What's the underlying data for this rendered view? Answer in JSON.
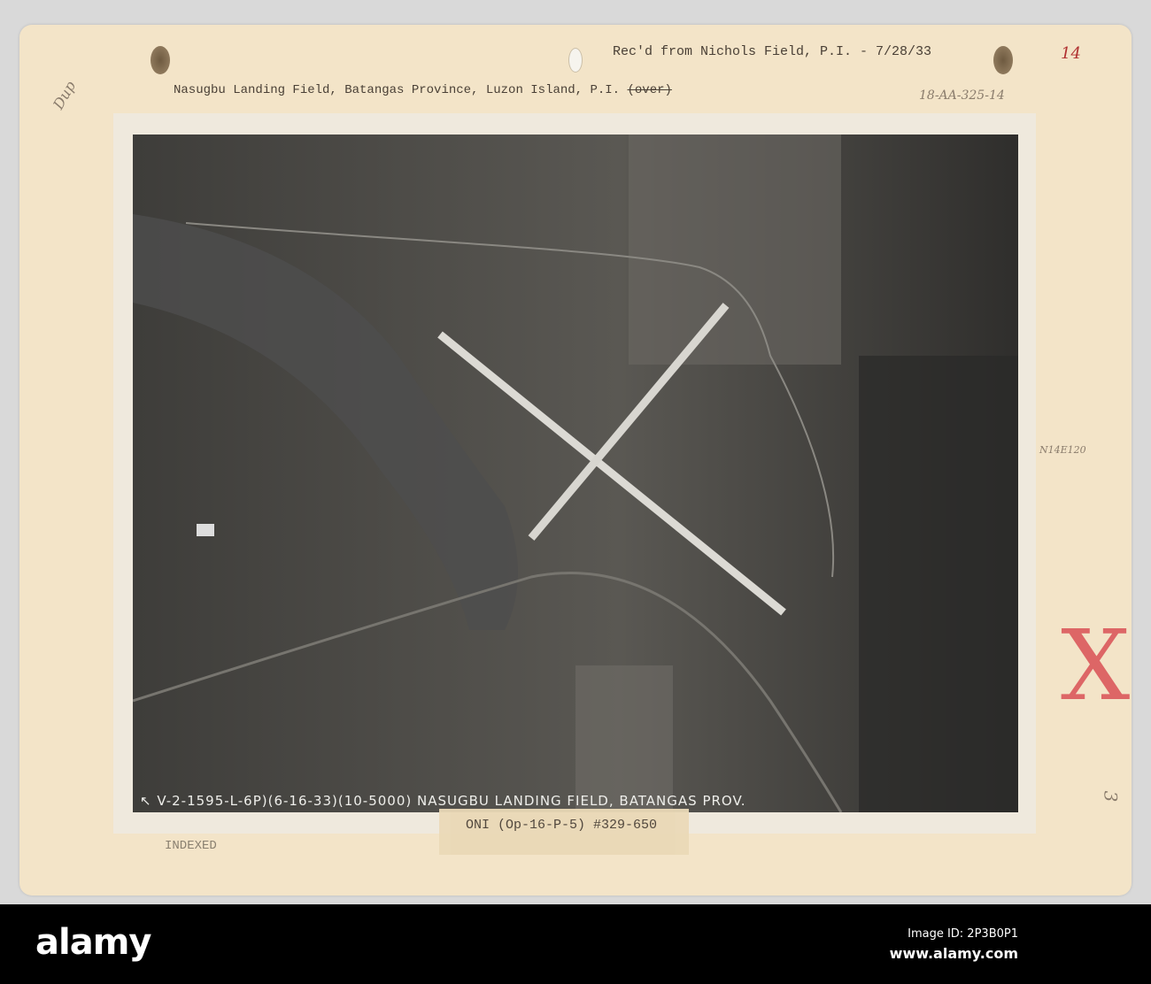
{
  "document": {
    "received_note": "Rec'd from Nichols Field, P.I. - 7/28/33",
    "title_line": "Nasugbu Landing Field, Batangas Province, Luzon Island, P.I.",
    "title_struck": "(over)",
    "handwritten_top_left": "Dup",
    "handwritten_top_right": "14",
    "file_number": "18-AA-325-14",
    "coordinates_note": "N14E120",
    "margin_mark": "X",
    "margin_number": "3",
    "photo_caption": "↖ V-2-1595-L-6P)(6-16-33)(10-5000) NASUGBU  LANDING  FIELD,  BATANGAS  PROV.",
    "tape_label": "ONI (Op-16-P-5) #329-650",
    "stamp": "INDEXED"
  },
  "footer": {
    "logo": "alamy",
    "image_id": "Image ID: 2P3B0P1",
    "url": "www.alamy.com"
  }
}
